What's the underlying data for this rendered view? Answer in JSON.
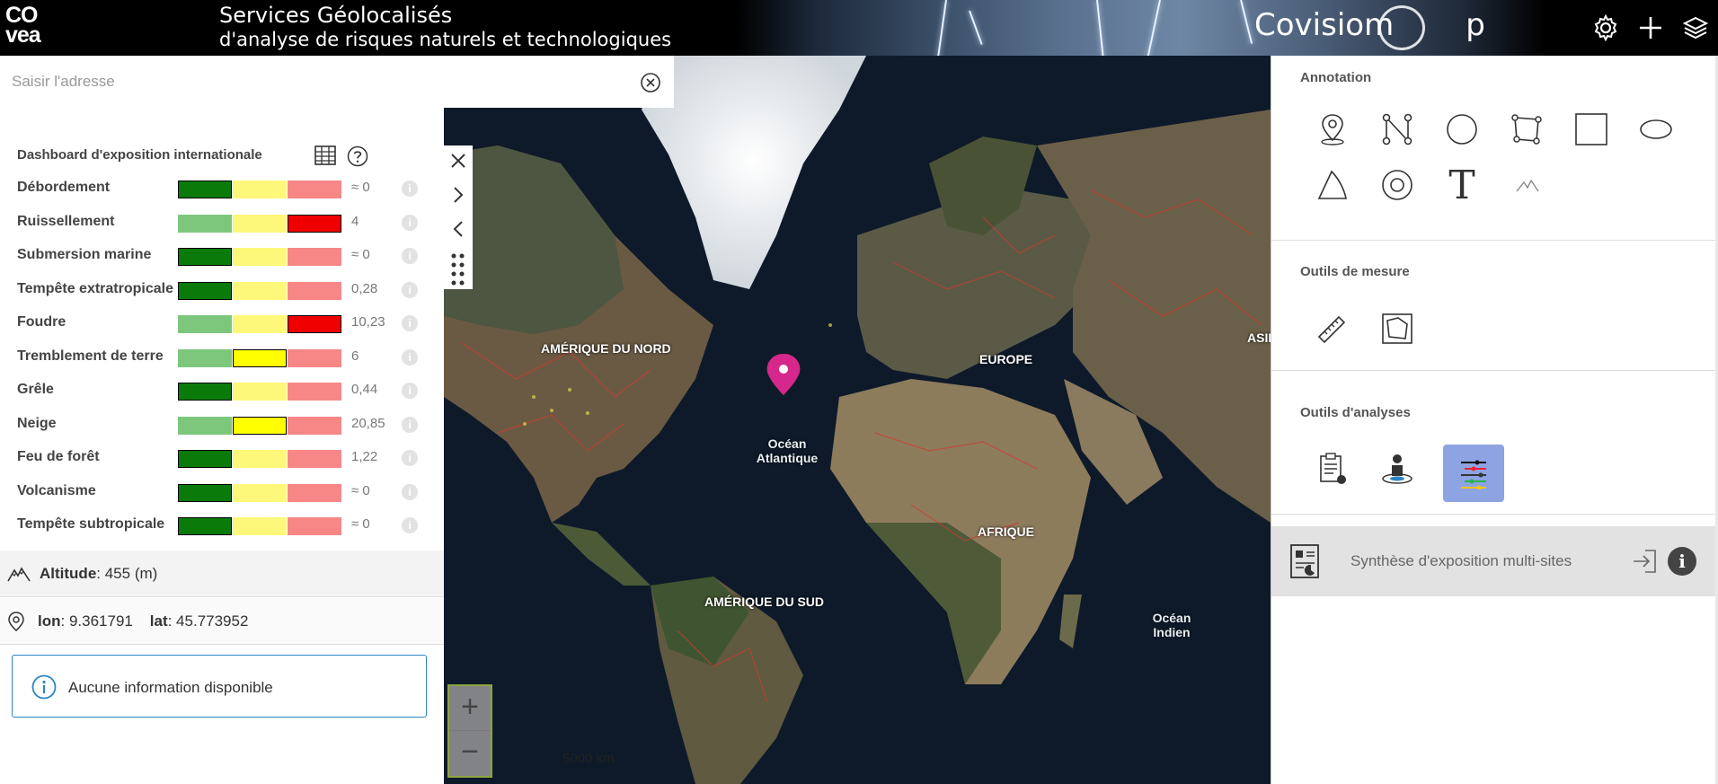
{
  "header": {
    "logo_line1": "CO",
    "logo_line2": "vea",
    "title_line1": "Services Géolocalisés",
    "title_line2": "d'analyse de risques naturels et technologiques",
    "brand_left": "Covisiom",
    "brand_right": "p"
  },
  "search": {
    "placeholder": "Saisir l'adresse"
  },
  "dashboard": {
    "title": "Dashboard d'exposition internationale",
    "rows": [
      {
        "label": "Débordement",
        "value": "≈ 0",
        "level": "low"
      },
      {
        "label": "Ruissellement",
        "value": "4",
        "level": "high"
      },
      {
        "label": "Submersion marine",
        "value": "≈ 0",
        "level": "low"
      },
      {
        "label": "Tempête extratropicale",
        "value": "0,28",
        "level": "low"
      },
      {
        "label": "Foudre",
        "value": "10,23",
        "level": "high"
      },
      {
        "label": "Tremblement de terre",
        "value": "6",
        "level": "medium"
      },
      {
        "label": "Grêle",
        "value": "0,44",
        "level": "low"
      },
      {
        "label": "Neige",
        "value": "20,85",
        "level": "medium"
      },
      {
        "label": "Feu de forêt",
        "value": "1,22",
        "level": "low"
      },
      {
        "label": "Volcanisme",
        "value": "≈ 0",
        "level": "low"
      },
      {
        "label": "Tempête subtropicale",
        "value": "≈ 0",
        "level": "low"
      }
    ],
    "info_glyph": "i"
  },
  "altitude": {
    "label": "Altitude",
    "value": ": 455 (m)"
  },
  "coords": {
    "lon_label": "lon",
    "lon_value": ": 9.361791",
    "lat_label": "lat",
    "lat_value": ": 45.773952"
  },
  "info_message": "Aucune information disponible",
  "map": {
    "labels": {
      "north_america": "AMÉRIQUE DU NORD",
      "europe": "EUROPE",
      "asia": "ASIE",
      "africa": "AFRIQUE",
      "south_america": "AMÉRIQUE DU SUD",
      "atlantic_line1": "Océan",
      "atlantic_line2": "Atlantique",
      "indian_line1": "Océan",
      "indian_line2": "Indien"
    },
    "scale": "5000 km",
    "zoom_in": "+",
    "zoom_out": "−"
  },
  "right_panel": {
    "annotation_title": "Annotation",
    "measure_title": "Outils de mesure",
    "analysis_title": "Outils d'analyses",
    "text_tool_glyph": "T",
    "multisite_label": "Synthèse d'exposition multi-sites",
    "multisite_info": "i"
  },
  "colors": {
    "dark_green": "#0a7a0a",
    "light_green": "#7dc77d",
    "yellow": "#fdf77a",
    "bright_yellow": "#ffff00",
    "light_red": "#f78787",
    "red": "#f00000",
    "active_tool": "#8da3e2"
  }
}
